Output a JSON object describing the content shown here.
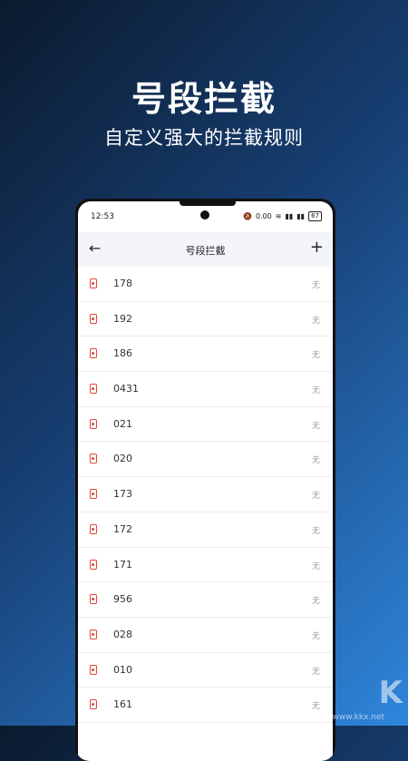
{
  "hero": {
    "title": "号段拦截",
    "subtitle": "自定义强大的拦截规则"
  },
  "status_bar": {
    "time": "12:53",
    "speed": "0.00",
    "battery": "67"
  },
  "app_bar": {
    "title": "号段拦截",
    "back_icon": "←",
    "add_icon": "+"
  },
  "rules": [
    {
      "prefix": "178",
      "status": "无"
    },
    {
      "prefix": "192",
      "status": "无"
    },
    {
      "prefix": "186",
      "status": "无"
    },
    {
      "prefix": "0431",
      "status": "无"
    },
    {
      "prefix": "021",
      "status": "无"
    },
    {
      "prefix": "020",
      "status": "无"
    },
    {
      "prefix": "173",
      "status": "无"
    },
    {
      "prefix": "172",
      "status": "无"
    },
    {
      "prefix": "171",
      "status": "无"
    },
    {
      "prefix": "956",
      "status": "无"
    },
    {
      "prefix": "028",
      "status": "无"
    },
    {
      "prefix": "010",
      "status": "无"
    },
    {
      "prefix": "161",
      "status": "无"
    }
  ],
  "watermark": {
    "logo_text": "K",
    "url": "www.kkx.net"
  },
  "colors": {
    "accent_red": "#e0463a",
    "gradient_dark": "#0b1a2e",
    "gradient_light": "#2f86dc"
  }
}
